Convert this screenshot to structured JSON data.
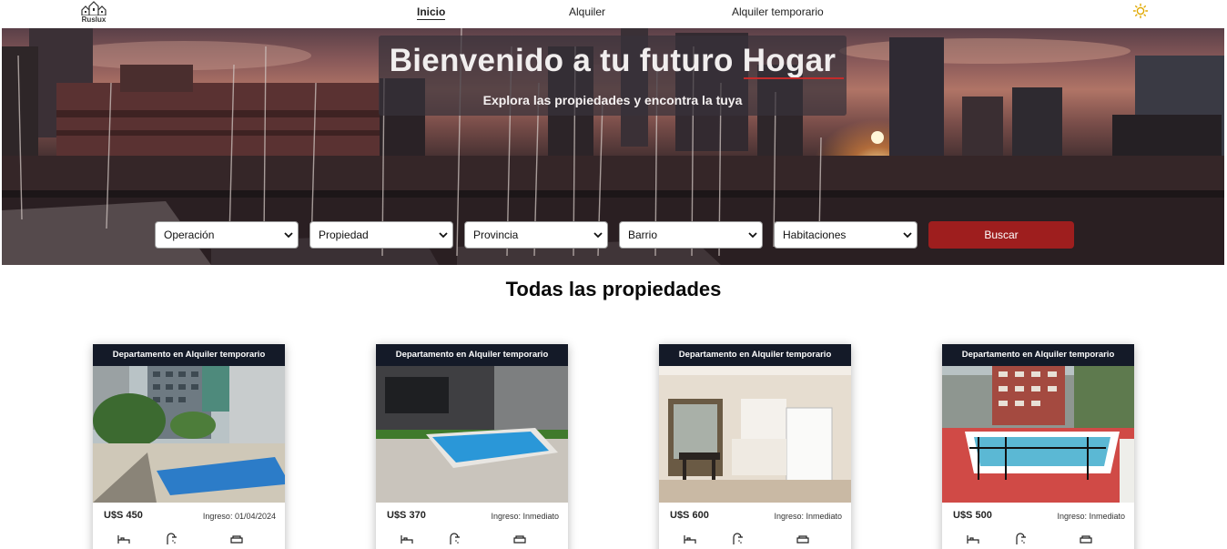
{
  "brand": {
    "name": "Ruslux",
    "logo_icon": "building-skyline-icon"
  },
  "nav": {
    "links": [
      {
        "label": "Inicio",
        "active": true
      },
      {
        "label": "Alquiler",
        "active": false
      },
      {
        "label": "Alquiler temporario",
        "active": false
      }
    ],
    "theme_icon": "sun-icon"
  },
  "hero": {
    "title": "Bienvenido a tu futuro Hogar",
    "subtitle": "Explora las propiedades y encontra la tuya",
    "accent_color": "#c42b2b"
  },
  "filters": {
    "operacion": "Operación",
    "propiedad": "Propiedad",
    "provincia": "Provincia",
    "barrio": "Barrio",
    "habitaciones": "Habitaciones",
    "search_label": "Buscar",
    "search_color": "#9e1e1e"
  },
  "section_title": "Todas las propiedades",
  "cards": [
    {
      "title": "Departamento en Alquiler temporario",
      "price": "U$S 450",
      "ingreso": "Ingreso: 01/04/2024"
    },
    {
      "title": "Departamento en Alquiler temporario",
      "price": "U$S 370",
      "ingreso": "Ingreso: Inmediato"
    },
    {
      "title": "Departamento en Alquiler temporario",
      "price": "U$S 600",
      "ingreso": "Ingreso: Inmediato"
    },
    {
      "title": "Departamento en Alquiler temporario",
      "price": "U$S 500",
      "ingreso": "Ingreso: Inmediato"
    }
  ],
  "card_icons": [
    "bed-icon",
    "shower-icon",
    "sofa-icon"
  ],
  "card_header_color": "#141a28"
}
